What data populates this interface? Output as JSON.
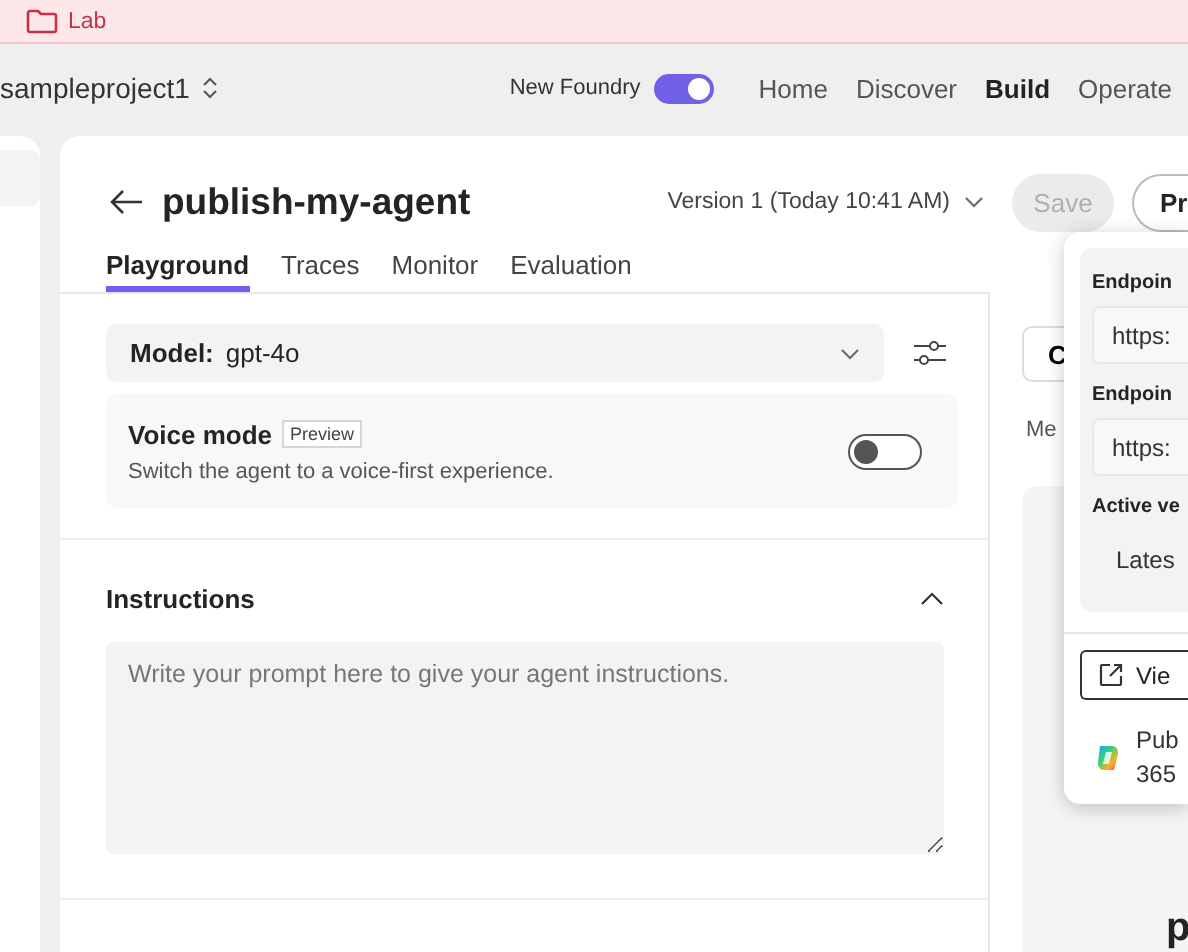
{
  "breadcrumb": {
    "label": "Lab"
  },
  "header": {
    "project": "sampleproject1",
    "new_foundry": {
      "label": "New Foundry",
      "on": true
    },
    "nav": [
      {
        "label": "Home",
        "selected": false
      },
      {
        "label": "Discover",
        "selected": false
      },
      {
        "label": "Build",
        "selected": true
      },
      {
        "label": "Operate",
        "selected": false
      }
    ]
  },
  "agent": {
    "title": "publish-my-agent",
    "version": "Version 1 (Today 10:41 AM)",
    "save": {
      "label": "Save",
      "disabled": true
    },
    "publish_button": "Pr",
    "tabs": [
      {
        "label": "Playground",
        "selected": true
      },
      {
        "label": "Traces",
        "selected": false
      },
      {
        "label": "Monitor",
        "selected": false
      },
      {
        "label": "Evaluation",
        "selected": false
      }
    ]
  },
  "model": {
    "label": "Model:",
    "value": "gpt-4o"
  },
  "voice_mode": {
    "title": "Voice mode",
    "badge": "Preview",
    "description": "Switch the agent to a voice-first experience.",
    "on": false
  },
  "instructions": {
    "title": "Instructions",
    "expanded": true,
    "placeholder": "Write your prompt here to give your agent instructions."
  },
  "chat_panel": {
    "button": "C",
    "tab": "Me",
    "heading": "p"
  },
  "popover": {
    "fields": [
      {
        "kind": "input",
        "label": "Endpoin",
        "value": "https:"
      },
      {
        "kind": "input",
        "label": "Endpoin",
        "value": "https:"
      },
      {
        "kind": "text",
        "label": "Active ve",
        "value": "Lates"
      }
    ],
    "actions": [
      {
        "kind": "link",
        "lines": [
          "Vie"
        ]
      },
      {
        "kind": "app",
        "lines": [
          "Pub",
          "365"
        ]
      }
    ]
  }
}
